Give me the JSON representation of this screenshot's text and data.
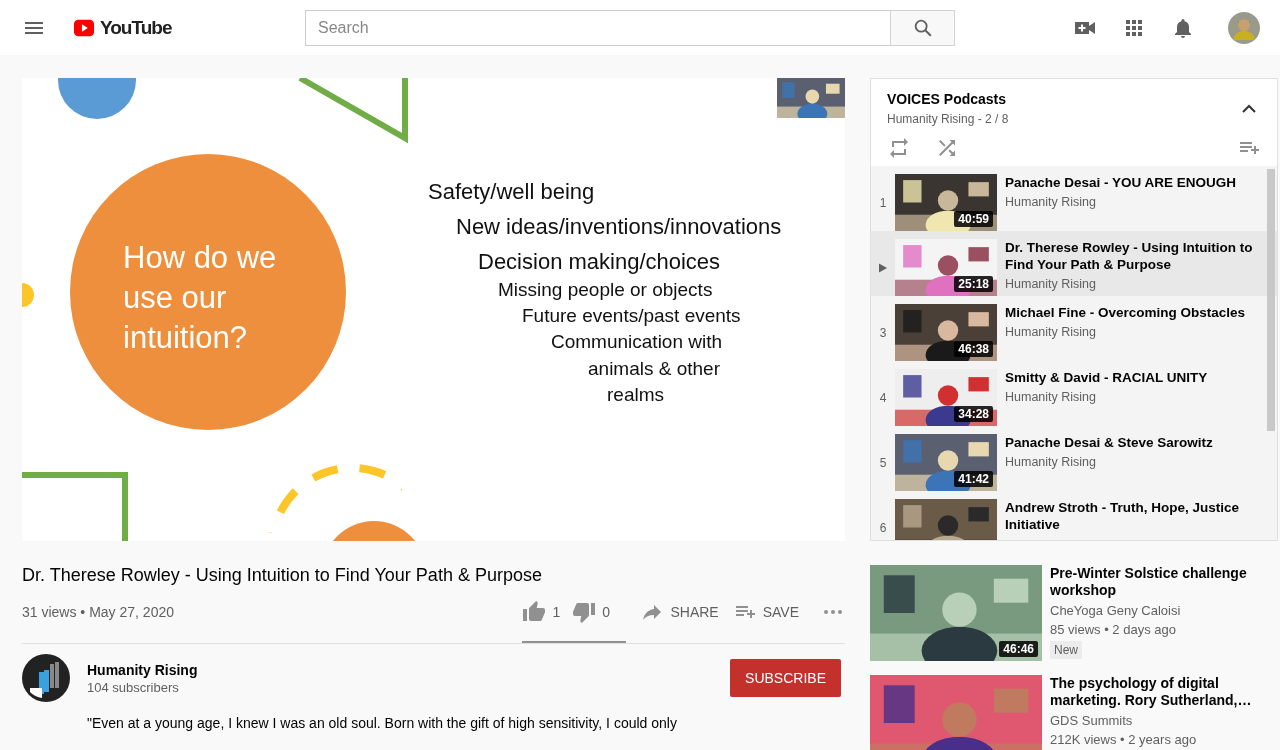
{
  "header": {
    "logo_text": "YouTube",
    "search": {
      "placeholder": "Search"
    }
  },
  "video": {
    "slide": {
      "heading": "How do we use our intuition?",
      "bullets": [
        "Safety/well being",
        "New ideas/inventions/innovations",
        "Decision making/choices",
        "Missing people or objects",
        "Future events/past events",
        "Communication with",
        "animals & other",
        "realms"
      ]
    }
  },
  "title": "Dr. Therese Rowley - Using Intuition to Find Your Path & Purpose",
  "meta": "31 views • May 27, 2020",
  "actions": {
    "likes": "1",
    "dislikes": "0",
    "like_ratio": {
      "level": 1
    },
    "share": "SHARE",
    "save": "SAVE"
  },
  "channel": {
    "name": "Humanity Rising",
    "subscribers": "104 subscribers",
    "subscribe": "SUBSCRIBE"
  },
  "description": "\"Even at a young age, I knew I was an old soul. Born with the gift of high sensitivity, I could only",
  "playlist": {
    "title": "VOICES Podcasts",
    "subtitle": "Humanity Rising - 2 / 8",
    "expanded": true,
    "items": [
      {
        "index": "1",
        "title": "Panache Desai - YOU ARE ENOUGH",
        "channel": "Humanity Rising",
        "duration": "40:59",
        "selected": false
      },
      {
        "title": "Dr. Therese Rowley - Using Intuition to Find Your Path & Purpose",
        "channel": "Humanity Rising",
        "duration": "25:18",
        "selected": true
      },
      {
        "index": "3",
        "title": "Michael Fine - Overcoming Obstacles",
        "channel": "Humanity Rising",
        "duration": "46:38",
        "selected": false
      },
      {
        "index": "4",
        "title": "Smitty & David - RACIAL UNITY",
        "channel": "Humanity Rising",
        "duration": "34:28",
        "selected": false
      },
      {
        "index": "5",
        "title": "Panache Desai & Steve Sarowitz",
        "channel": "Humanity Rising",
        "duration": "41:42",
        "selected": false
      },
      {
        "index": "6",
        "title": "Andrew Stroth - Truth, Hope, Justice Initiative",
        "selected": false
      }
    ]
  },
  "recommended": [
    {
      "title": "Pre-Winter Solstice challenge workshop",
      "channel": "CheYoga Geny Caloisi",
      "meta": "85 views • 2 days ago",
      "badge": "New",
      "duration": "46:46"
    },
    {
      "title": "The psychology of digital marketing. Rory Sutherland,…",
      "channel": "GDS Summits",
      "meta": "212K views • 2 years ago"
    }
  ]
}
